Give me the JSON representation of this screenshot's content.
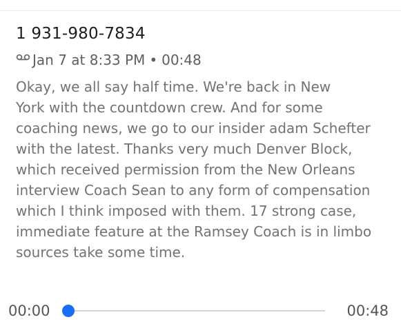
{
  "voicemail": {
    "caller": "1 931-980-7834",
    "icon": "voicemail-icon",
    "date": "Jan 7 at 8:33 PM",
    "separator": "•",
    "duration": "00:48",
    "transcript_lines": [
      "Okay, we all say half time. We're back in New",
      "York with the countdown crew. And for some",
      "coaching news, we go to our insider adam Schefter",
      "with the latest. Thanks very much Denver Block,",
      "which received permission from the New Orleans",
      "interview Coach Sean to any form of compensation",
      "which I think imposed with them. 17 strong case,",
      "immediate feature at the Ramsey Coach is in limbo",
      "sources take some time."
    ]
  },
  "player": {
    "current_time": "00:00",
    "total_time": "00:48",
    "progress": 0,
    "accent_color": "#1b6df2"
  }
}
